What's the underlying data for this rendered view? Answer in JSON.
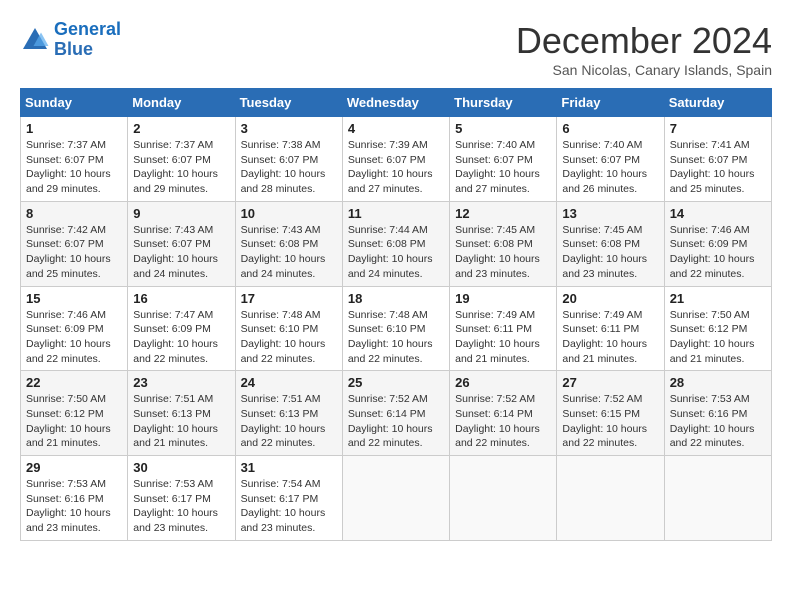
{
  "logo": {
    "line1": "General",
    "line2": "Blue"
  },
  "title": "December 2024",
  "location": "San Nicolas, Canary Islands, Spain",
  "weekdays": [
    "Sunday",
    "Monday",
    "Tuesday",
    "Wednesday",
    "Thursday",
    "Friday",
    "Saturday"
  ],
  "weeks": [
    [
      {
        "day": "1",
        "sunrise": "7:37 AM",
        "sunset": "6:07 PM",
        "daylight": "10 hours and 29 minutes."
      },
      {
        "day": "2",
        "sunrise": "7:37 AM",
        "sunset": "6:07 PM",
        "daylight": "10 hours and 29 minutes."
      },
      {
        "day": "3",
        "sunrise": "7:38 AM",
        "sunset": "6:07 PM",
        "daylight": "10 hours and 28 minutes."
      },
      {
        "day": "4",
        "sunrise": "7:39 AM",
        "sunset": "6:07 PM",
        "daylight": "10 hours and 27 minutes."
      },
      {
        "day": "5",
        "sunrise": "7:40 AM",
        "sunset": "6:07 PM",
        "daylight": "10 hours and 27 minutes."
      },
      {
        "day": "6",
        "sunrise": "7:40 AM",
        "sunset": "6:07 PM",
        "daylight": "10 hours and 26 minutes."
      },
      {
        "day": "7",
        "sunrise": "7:41 AM",
        "sunset": "6:07 PM",
        "daylight": "10 hours and 25 minutes."
      }
    ],
    [
      {
        "day": "8",
        "sunrise": "7:42 AM",
        "sunset": "6:07 PM",
        "daylight": "10 hours and 25 minutes."
      },
      {
        "day": "9",
        "sunrise": "7:43 AM",
        "sunset": "6:07 PM",
        "daylight": "10 hours and 24 minutes."
      },
      {
        "day": "10",
        "sunrise": "7:43 AM",
        "sunset": "6:08 PM",
        "daylight": "10 hours and 24 minutes."
      },
      {
        "day": "11",
        "sunrise": "7:44 AM",
        "sunset": "6:08 PM",
        "daylight": "10 hours and 24 minutes."
      },
      {
        "day": "12",
        "sunrise": "7:45 AM",
        "sunset": "6:08 PM",
        "daylight": "10 hours and 23 minutes."
      },
      {
        "day": "13",
        "sunrise": "7:45 AM",
        "sunset": "6:08 PM",
        "daylight": "10 hours and 23 minutes."
      },
      {
        "day": "14",
        "sunrise": "7:46 AM",
        "sunset": "6:09 PM",
        "daylight": "10 hours and 22 minutes."
      }
    ],
    [
      {
        "day": "15",
        "sunrise": "7:46 AM",
        "sunset": "6:09 PM",
        "daylight": "10 hours and 22 minutes."
      },
      {
        "day": "16",
        "sunrise": "7:47 AM",
        "sunset": "6:09 PM",
        "daylight": "10 hours and 22 minutes."
      },
      {
        "day": "17",
        "sunrise": "7:48 AM",
        "sunset": "6:10 PM",
        "daylight": "10 hours and 22 minutes."
      },
      {
        "day": "18",
        "sunrise": "7:48 AM",
        "sunset": "6:10 PM",
        "daylight": "10 hours and 22 minutes."
      },
      {
        "day": "19",
        "sunrise": "7:49 AM",
        "sunset": "6:11 PM",
        "daylight": "10 hours and 21 minutes."
      },
      {
        "day": "20",
        "sunrise": "7:49 AM",
        "sunset": "6:11 PM",
        "daylight": "10 hours and 21 minutes."
      },
      {
        "day": "21",
        "sunrise": "7:50 AM",
        "sunset": "6:12 PM",
        "daylight": "10 hours and 21 minutes."
      }
    ],
    [
      {
        "day": "22",
        "sunrise": "7:50 AM",
        "sunset": "6:12 PM",
        "daylight": "10 hours and 21 minutes."
      },
      {
        "day": "23",
        "sunrise": "7:51 AM",
        "sunset": "6:13 PM",
        "daylight": "10 hours and 21 minutes."
      },
      {
        "day": "24",
        "sunrise": "7:51 AM",
        "sunset": "6:13 PM",
        "daylight": "10 hours and 22 minutes."
      },
      {
        "day": "25",
        "sunrise": "7:52 AM",
        "sunset": "6:14 PM",
        "daylight": "10 hours and 22 minutes."
      },
      {
        "day": "26",
        "sunrise": "7:52 AM",
        "sunset": "6:14 PM",
        "daylight": "10 hours and 22 minutes."
      },
      {
        "day": "27",
        "sunrise": "7:52 AM",
        "sunset": "6:15 PM",
        "daylight": "10 hours and 22 minutes."
      },
      {
        "day": "28",
        "sunrise": "7:53 AM",
        "sunset": "6:16 PM",
        "daylight": "10 hours and 22 minutes."
      }
    ],
    [
      {
        "day": "29",
        "sunrise": "7:53 AM",
        "sunset": "6:16 PM",
        "daylight": "10 hours and 23 minutes."
      },
      {
        "day": "30",
        "sunrise": "7:53 AM",
        "sunset": "6:17 PM",
        "daylight": "10 hours and 23 minutes."
      },
      {
        "day": "31",
        "sunrise": "7:54 AM",
        "sunset": "6:17 PM",
        "daylight": "10 hours and 23 minutes."
      },
      null,
      null,
      null,
      null
    ]
  ]
}
